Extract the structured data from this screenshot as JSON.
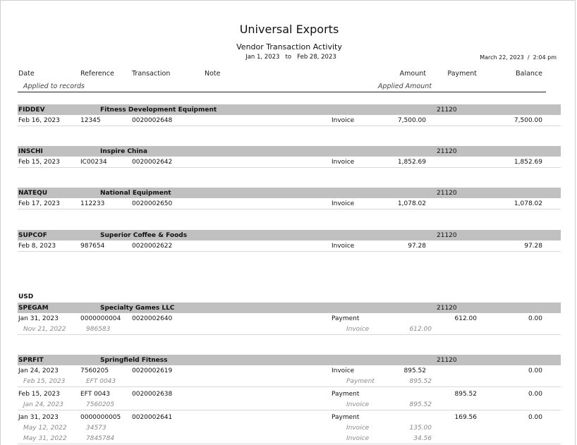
{
  "report": {
    "company": "Universal Exports",
    "title": "Vendor Transaction Activity",
    "date_range": "Jan 1, 2023   to   Feb 28, 2023",
    "printed": "March 22, 2023  /  2:04 pm"
  },
  "columns": {
    "date": "Date",
    "reference": "Reference",
    "transaction": "Transaction",
    "note": "Note",
    "amount": "Amount",
    "payment": "Payment",
    "balance": "Balance",
    "applied_to": "Applied to records",
    "applied_amount": "Applied Amount"
  },
  "currency_label": "USD",
  "vendors": [
    {
      "code": "FIDDEV",
      "name": "Fitness Development Equipment",
      "account": "21120",
      "rows": [
        {
          "date": "Feb 16, 2023",
          "ref": "12345",
          "txn": "0020002648",
          "type": "Invoice",
          "amount": "7,500.00",
          "payment": "",
          "balance": "7,500.00"
        }
      ]
    },
    {
      "code": "INSCHI",
      "name": "Inspire China",
      "account": "21120",
      "rows": [
        {
          "date": "Feb 15, 2023",
          "ref": "IC00234",
          "txn": "0020002642",
          "type": "Invoice",
          "amount": "1,852.69",
          "payment": "",
          "balance": "1,852.69"
        }
      ]
    },
    {
      "code": "NATEQU",
      "name": "National Equipment",
      "account": "21120",
      "rows": [
        {
          "date": "Feb 17, 2023",
          "ref": "112233",
          "txn": "0020002650",
          "type": "Invoice",
          "amount": "1,078.02",
          "payment": "",
          "balance": "1,078.02"
        }
      ]
    },
    {
      "code": "SUPCOF",
      "name": "Superior Coffee & Foods",
      "account": "21120",
      "rows": [
        {
          "date": "Feb 8, 2023",
          "ref": "987654",
          "txn": "0020002622",
          "type": "Invoice",
          "amount": "97.28",
          "payment": "",
          "balance": "97.28"
        }
      ]
    },
    {
      "code": "SPEGAM",
      "name": "Specialty Games LLC",
      "account": "21120",
      "rows": [
        {
          "date": "Jan 31, 2023",
          "ref": "0000000004",
          "txn": "0020002640",
          "type": "Payment",
          "amount": "",
          "payment": "612.00",
          "balance": "0.00",
          "applied": [
            {
              "date": "Nov 21, 2022",
              "ref": "986583",
              "type": "Invoice",
              "amount": "612.00"
            }
          ]
        }
      ]
    },
    {
      "code": "SPRFIT",
      "name": "Springfield Fitness",
      "account": "21120",
      "rows": [
        {
          "date": "Jan 24, 2023",
          "ref": "7560205",
          "txn": "0020002619",
          "type": "Invoice",
          "amount": "895.52",
          "payment": "",
          "balance": "0.00",
          "applied": [
            {
              "date": "Feb 15, 2023",
              "ref": "EFT 0043",
              "type": "Payment",
              "amount": "895.52"
            }
          ]
        },
        {
          "date": "Feb 15, 2023",
          "ref": "EFT 0043",
          "txn": "0020002638",
          "type": "Payment",
          "amount": "",
          "payment": "895.52",
          "balance": "0.00",
          "applied": [
            {
              "date": "Jan 24, 2023",
              "ref": "7560205",
              "type": "Invoice",
              "amount": "895.52"
            }
          ]
        },
        {
          "date": "Jan 31, 2023",
          "ref": "0000000005",
          "txn": "0020002641",
          "type": "Payment",
          "amount": "",
          "payment": "169.56",
          "balance": "0.00",
          "applied": [
            {
              "date": "May 12, 2022",
              "ref": "34573",
              "type": "Invoice",
              "amount": "135.00"
            },
            {
              "date": "May 31, 2022",
              "ref": "7845784",
              "type": "Invoice",
              "amount": "34.56"
            }
          ]
        }
      ]
    }
  ]
}
